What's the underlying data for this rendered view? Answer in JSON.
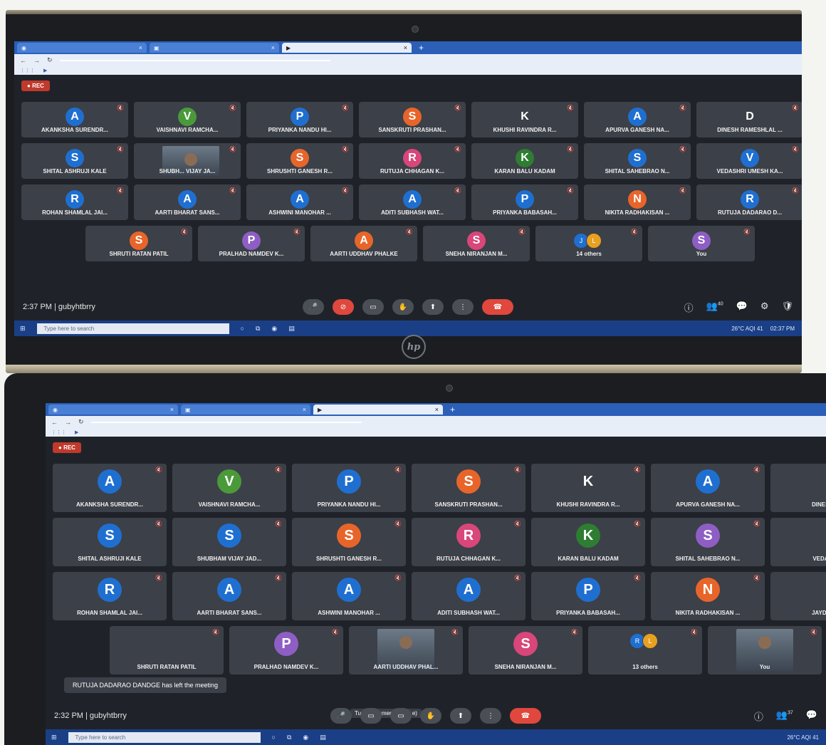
{
  "top_laptop": {
    "recording_label": "REC",
    "meeting_info": "2:37 PM | gubyhtbrry",
    "rows": [
      [
        {
          "letter": "A",
          "color": "#1f6fd1",
          "name": "AKANKSHA SURENDR..."
        },
        {
          "letter": "V",
          "color": "#4a9a3a",
          "name": "VAISHNAVI RAMCHA..."
        },
        {
          "letter": "P",
          "color": "#1f6fd1",
          "name": "PRIYANKA NANDU HI..."
        },
        {
          "letter": "S",
          "color": "#e8652a",
          "name": "SANSKRUTI PRASHAN..."
        },
        {
          "letter": "K",
          "color": "#3c4048",
          "name": "KHUSHI RAVINDRA R..."
        },
        {
          "letter": "A",
          "color": "#1f6fd1",
          "name": "APURVA GANESH NA..."
        },
        {
          "letter": "D",
          "color": "#3c4048",
          "name": "DINESH RAMESHLAL ..."
        }
      ],
      [
        {
          "letter": "S",
          "color": "#1f6fd1",
          "name": "SHITAL ASHRUJI KALE"
        },
        {
          "letter": "",
          "color": "",
          "name": "SHUBH... VIJAY JA...",
          "video": true
        },
        {
          "letter": "S",
          "color": "#e8652a",
          "name": "SHRUSHTI GANESH R..."
        },
        {
          "letter": "R",
          "color": "#d8467a",
          "name": "RUTUJA CHHAGAN K..."
        },
        {
          "letter": "K",
          "color": "#2e7d32",
          "name": "KARAN BALU KADAM"
        },
        {
          "letter": "S",
          "color": "#1f6fd1",
          "name": "SHITAL SAHEBRAO N..."
        },
        {
          "letter": "V",
          "color": "#1f6fd1",
          "name": "VEDASHRI UMESH KA..."
        }
      ],
      [
        {
          "letter": "R",
          "color": "#1f6fd1",
          "name": "ROHAN SHAMLAL JAI..."
        },
        {
          "letter": "A",
          "color": "#1f6fd1",
          "name": "AARTI BHARAT SANS..."
        },
        {
          "letter": "A",
          "color": "#1f6fd1",
          "name": "ASHWINI MANOHAR ..."
        },
        {
          "letter": "A",
          "color": "#1f6fd1",
          "name": "ADITI SUBHASH WAT..."
        },
        {
          "letter": "P",
          "color": "#1f6fd1",
          "name": "PRIYANKA BABASAH..."
        },
        {
          "letter": "N",
          "color": "#e8652a",
          "name": "NIKITA RADHAKISAN ..."
        },
        {
          "letter": "R",
          "color": "#1f6fd1",
          "name": "RUTUJA DADARAO D..."
        }
      ],
      [
        {
          "letter": "S",
          "color": "#e8652a",
          "name": "SHRUTI RATAN PATIL"
        },
        {
          "letter": "P",
          "color": "#8e5ec4",
          "name": "PRALHAD NAMDEV K..."
        },
        {
          "letter": "A",
          "color": "#e8652a",
          "name": "AARTI UDDHAV PHALKE"
        },
        {
          "letter": "S",
          "color": "#d8467a",
          "name": "SNEHA NIRANJAN M..."
        },
        {
          "letter": "",
          "color": "",
          "name": "14 others",
          "others": [
            "J",
            "L"
          ]
        },
        {
          "letter": "S",
          "color": "#8e5ec4",
          "name": "You"
        }
      ]
    ],
    "controls": {
      "participants_count": "40"
    },
    "taskbar": {
      "search_placeholder": "Type here to search",
      "weather": "26°C AQI 41",
      "clock": "02:37 PM"
    }
  },
  "bottom_laptop": {
    "recording_label": "REC",
    "meeting_info": "2:32 PM | gubyhtbrry",
    "tooltip": "Turn on camera (ctrl + e)",
    "toast": "RUTUJA DADARAO DANDGE has left the meeting",
    "rows": [
      [
        {
          "letter": "A",
          "color": "#1f6fd1",
          "name": "AKANKSHA SURENDR..."
        },
        {
          "letter": "V",
          "color": "#4a9a3a",
          "name": "VAISHNAVI RAMCHA..."
        },
        {
          "letter": "P",
          "color": "#1f6fd1",
          "name": "PRIYANKA NANDU HI..."
        },
        {
          "letter": "S",
          "color": "#e8652a",
          "name": "SANSKRUTI PRASHAN..."
        },
        {
          "letter": "K",
          "color": "#3c4048",
          "name": "KHUSHI RAVINDRA R..."
        },
        {
          "letter": "A",
          "color": "#1f6fd1",
          "name": "APURVA GANESH NA..."
        },
        {
          "letter": "",
          "color": "",
          "name": "DINESH RA"
        }
      ],
      [
        {
          "letter": "S",
          "color": "#1f6fd1",
          "name": "SHITAL ASHRUJI KALE"
        },
        {
          "letter": "S",
          "color": "#1f6fd1",
          "name": "SHUBHAM VIJAY JAD..."
        },
        {
          "letter": "S",
          "color": "#e8652a",
          "name": "SHRUSHTI GANESH R..."
        },
        {
          "letter": "R",
          "color": "#d8467a",
          "name": "RUTUJA CHHAGAN K..."
        },
        {
          "letter": "K",
          "color": "#2e7d32",
          "name": "KARAN BALU KADAM"
        },
        {
          "letter": "S",
          "color": "#8e5ec4",
          "name": "SHITAL SAHEBRAO N..."
        },
        {
          "letter": "",
          "color": "",
          "name": "VEDASHRI"
        }
      ],
      [
        {
          "letter": "R",
          "color": "#1f6fd1",
          "name": "ROHAN SHAMLAL JAI..."
        },
        {
          "letter": "A",
          "color": "#1f6fd1",
          "name": "AARTI BHARAT SANS..."
        },
        {
          "letter": "A",
          "color": "#1f6fd1",
          "name": "ASHWINI MANOHAR ..."
        },
        {
          "letter": "A",
          "color": "#1f6fd1",
          "name": "ADITI SUBHASH WAT..."
        },
        {
          "letter": "P",
          "color": "#1f6fd1",
          "name": "PRIYANKA BABASAH..."
        },
        {
          "letter": "N",
          "color": "#e8652a",
          "name": "NIKITA RADHAKISAN ..."
        },
        {
          "letter": "",
          "color": "",
          "name": "JAYDEEP S"
        }
      ],
      [
        {
          "letter": "",
          "color": "",
          "name": "SHRUTI RATAN PATIL"
        },
        {
          "letter": "P",
          "color": "#8e5ec4",
          "name": "PRALHAD NAMDEV K..."
        },
        {
          "letter": "",
          "color": "",
          "name": "AARTI UDDHAV PHAL...",
          "video": true
        },
        {
          "letter": "S",
          "color": "#d8467a",
          "name": "SNEHA NIRANJAN M..."
        },
        {
          "letter": "",
          "color": "",
          "name": "13 others",
          "others": [
            "R",
            "L"
          ]
        },
        {
          "letter": "",
          "color": "",
          "name": "You",
          "video": true
        }
      ]
    ],
    "controls": {
      "participants_count": "37"
    },
    "taskbar": {
      "search_placeholder": "Type here to search",
      "weather": "26°C AQI 41"
    }
  }
}
